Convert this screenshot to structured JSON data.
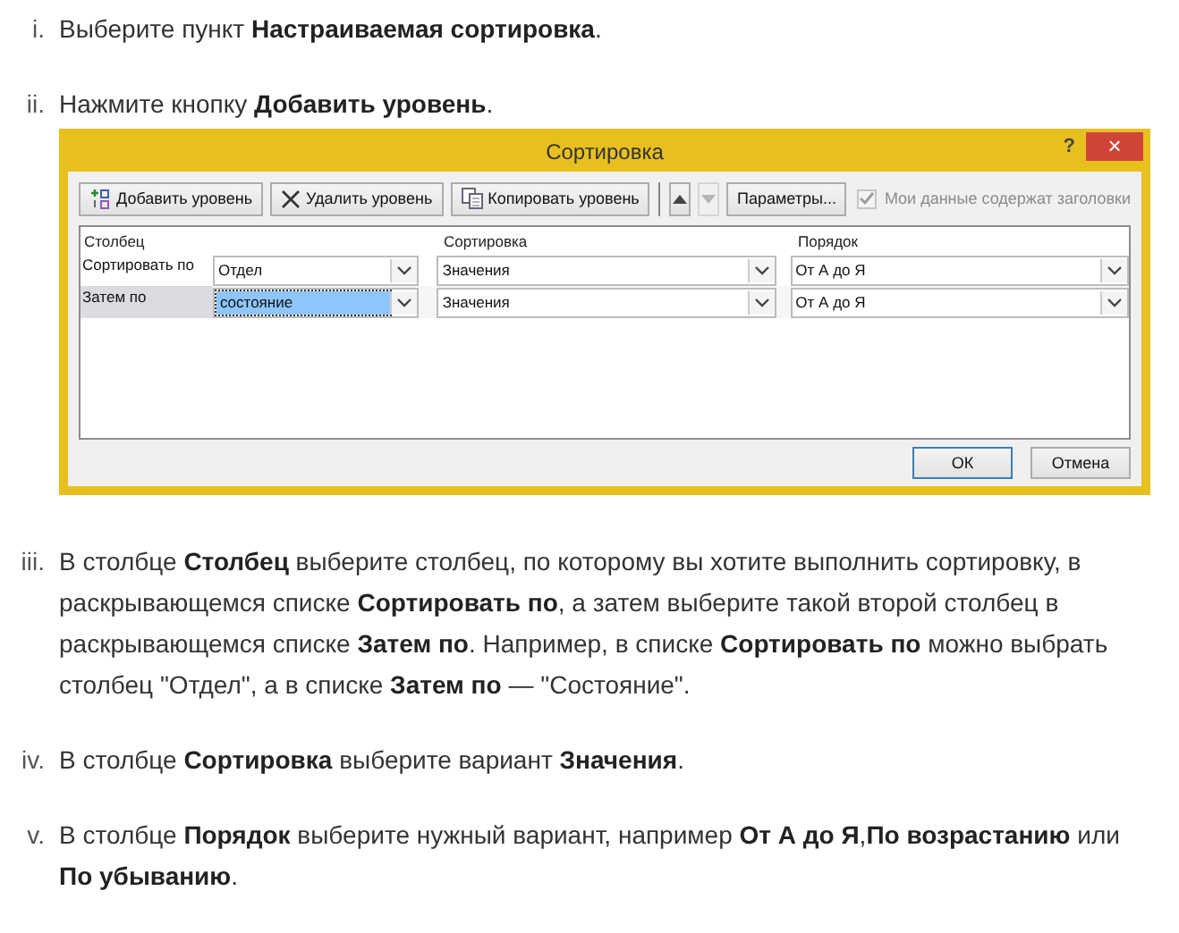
{
  "steps": [
    {
      "marker": "i.",
      "text": "Выберите пункт **Настраиваемая сортировка**."
    },
    {
      "marker": "ii.",
      "text": "Нажмите кнопку **Добавить уровень**.",
      "dialog": {
        "title": "Сортировка",
        "help": "?",
        "close": "×",
        "toolbar": [
          {
            "kind": "add",
            "label": "Добавить уровень",
            "disabled": false
          },
          {
            "kind": "delete",
            "label": "Удалить уровень",
            "disabled": false
          },
          {
            "kind": "copy",
            "label": "Копировать уровень",
            "disabled": false
          },
          {
            "kind": "up",
            "disabled": false
          },
          {
            "kind": "down",
            "disabled": true
          },
          {
            "kind": "text",
            "label": "Параметры...",
            "disabled": false
          }
        ],
        "headers_checkbox": {
          "label": "Мои данные содержат заголовки",
          "checked": true,
          "disabled": true
        },
        "columns": [
          "Столбец",
          "Сортировка",
          "Порядок"
        ],
        "rows": [
          {
            "label": "Сортировать по",
            "selected": false,
            "cells": [
              {
                "value": "Отдел",
                "selected": false
              },
              {
                "value": "Значения",
                "selected": false
              },
              {
                "value": "От А до Я",
                "selected": false
              }
            ]
          },
          {
            "label": "Затем по",
            "selected": true,
            "cells": [
              {
                "value": "состояние",
                "selected": true
              },
              {
                "value": "Значения",
                "selected": false
              },
              {
                "value": "От А до Я",
                "selected": false
              }
            ]
          }
        ],
        "buttons": [
          {
            "label": "ОК",
            "default": true
          },
          {
            "label": "Отмена",
            "default": false
          }
        ]
      }
    },
    {
      "marker": "iii.",
      "text": "В столбце **Столбец** выберите столбец, по которому вы хотите выполнить сортировку, в раскрывающемся списке **Сортировать по**, а затем выберите такой второй столбец в раскрывающемся списке **Затем по**. Например, в списке **Сортировать по** можно выбрать столбец \"Отдел\", а в списке **Затем по** — \"Состояние\"."
    },
    {
      "marker": "iv.",
      "text": "В столбце **Сортировка** выберите вариант **Значения**."
    },
    {
      "marker": "v.",
      "text": "В столбце **Порядок** выберите нужный вариант, например **От А до Я**,**По возрастанию** или **По убыванию**."
    }
  ]
}
